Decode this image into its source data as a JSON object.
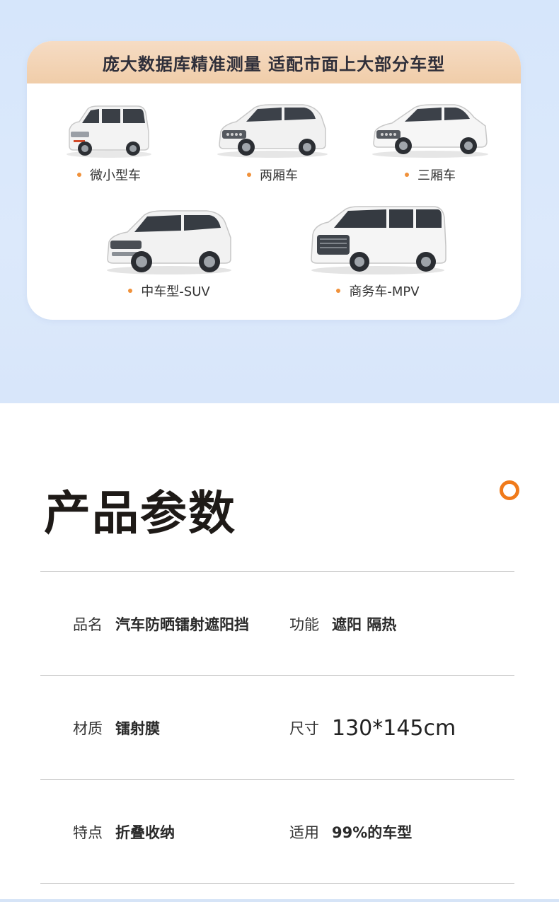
{
  "banner": {
    "title": "庞大数据库精准测量  适配市面上大部分车型",
    "cars": [
      {
        "label": "微小型车",
        "icon": "micro-car-icon",
        "color": "#f4f4f4"
      },
      {
        "label": "两厢车",
        "icon": "hatchback-car-icon",
        "color": "#f1f1f1"
      },
      {
        "label": "三厢车",
        "icon": "sedan-car-icon",
        "color": "#f6f6f6"
      },
      {
        "label": "中车型-SUV",
        "icon": "suv-car-icon",
        "color": "#f2f2f2"
      },
      {
        "label": "商务车-MPV",
        "icon": "mpv-car-icon",
        "color": "#f5f5f5"
      }
    ],
    "accent": "#f0913a"
  },
  "params": {
    "title": "产品参数",
    "accent": "#f07a1a",
    "rows": [
      {
        "k1": "品名",
        "v1": "汽车防晒镭射遮阳挡",
        "k2": "功能",
        "v2": "遮阳 隔热"
      },
      {
        "k1": "材质",
        "v1": "镭射膜",
        "k2": "尺寸",
        "v2": "130*145cm"
      },
      {
        "k1": "特点",
        "v1": "折叠收纳",
        "k2": "适用",
        "v2": "99%的车型"
      }
    ]
  }
}
